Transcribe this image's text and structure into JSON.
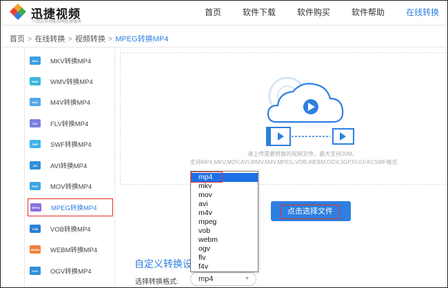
{
  "header": {
    "brand": "迅捷视频",
    "slogan": "一站式多功能视频处理服务",
    "nav": [
      {
        "label": "首页",
        "active": false
      },
      {
        "label": "软件下载",
        "active": false
      },
      {
        "label": "软件购买",
        "active": false
      },
      {
        "label": "软件帮助",
        "active": false
      },
      {
        "label": "在线转换",
        "active": true
      }
    ]
  },
  "breadcrumb": {
    "items": [
      "首页",
      "在线转换",
      "视频转换"
    ],
    "separator": ">",
    "current": "MPEG转换MP4"
  },
  "sidebar": {
    "items": [
      {
        "label": "MKV转换MP4",
        "badge": "MKV",
        "color": "#3c9ee6"
      },
      {
        "label": "WMV转换MP4",
        "badge": "WMV",
        "color": "#38b6d9"
      },
      {
        "label": "M4V转换MP4",
        "badge": "M4V",
        "color": "#52a8e8"
      },
      {
        "label": "FLV转换MP4",
        "badge": "FLV",
        "color": "#7b7fe0"
      },
      {
        "label": "SWF转换MP4",
        "badge": "SWF",
        "color": "#3fb3e8"
      },
      {
        "label": "AVI转换MP4",
        "badge": "AVI",
        "color": "#2f8fd8"
      },
      {
        "label": "MOV转换MP4",
        "badge": "MOV",
        "color": "#3aa7e3"
      },
      {
        "label": "MPEG转换MP4",
        "badge": "MPEG",
        "color": "#8b6fe0",
        "selected": true
      },
      {
        "label": "VOB转换MP4",
        "badge": "VOB",
        "color": "#2a7fd4"
      },
      {
        "label": "WEBM转换MP4",
        "badge": "WEBM",
        "color": "#f0803c"
      },
      {
        "label": "OGV转换MP4",
        "badge": "OGV",
        "color": "#2f8fd8"
      }
    ]
  },
  "upload": {
    "hint_line1": "请上传需要转换的视频文件，最大支持20M，",
    "hint_line2": "支持MP4,MKV,MOV,AVI,WMV,M4V,MPEG,VOB,WEBM,OGV,3GP,FLV,F4V,SWF格式",
    "button_label": "点击选择文件"
  },
  "custom": {
    "title": "自定义转换设置",
    "format_label": "选择转换格式:",
    "selected_format": "mp4",
    "options": [
      "mp4",
      "mkv",
      "mov",
      "avi",
      "m4v",
      "mpeg",
      "vob",
      "webm",
      "ogv",
      "flv",
      "f4v"
    ]
  },
  "colors": {
    "accent": "#2e7fe0",
    "highlight_border": "#e0302a",
    "dropdown_highlight": "#1e6fe8"
  }
}
